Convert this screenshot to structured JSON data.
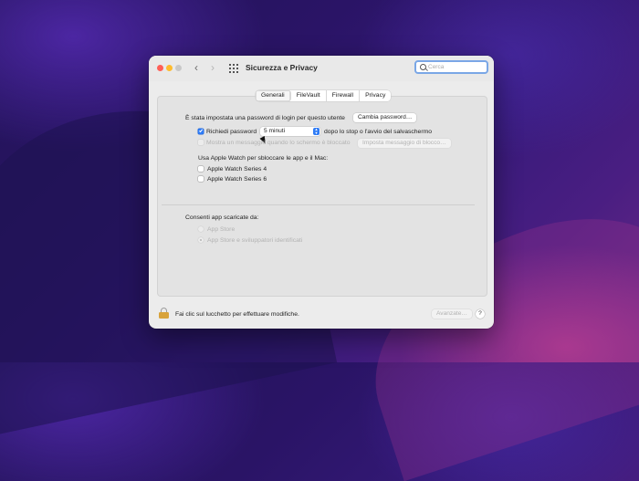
{
  "window": {
    "title": "Sicurezza e Privacy",
    "search_placeholder": "Cerca"
  },
  "tabs": [
    {
      "label": "Generali",
      "active": true
    },
    {
      "label": "FileVault",
      "active": false
    },
    {
      "label": "Firewall",
      "active": false
    },
    {
      "label": "Privacy",
      "active": false
    }
  ],
  "general": {
    "password_set_text": "È stata impostata una password di login per questo utente",
    "change_password_button": "Cambia password…",
    "require_password_label": "Richiedi password",
    "require_password_checked": true,
    "require_password_delay": "5 minuti",
    "require_password_suffix": "dopo lo stop o l'avvio del salvaschermo",
    "show_message_label": "Mostra un messaggio quando lo schermo è bloccato",
    "set_lock_message_button": "Imposta messaggio di blocco…",
    "apple_watch_title": "Usa Apple Watch per sbloccare le app e il Mac:",
    "watches": [
      {
        "label": "Apple Watch Series 4",
        "checked": false
      },
      {
        "label": "Apple Watch Series 6",
        "checked": false
      }
    ],
    "allow_apps_title": "Consenti app scaricate da:",
    "allow_options": [
      {
        "label": "App Store",
        "selected": false
      },
      {
        "label": "App Store e sviluppatori identificati",
        "selected": true
      }
    ]
  },
  "footer": {
    "lock_text": "Fai clic sul lucchetto per effettuare modifiche.",
    "advanced_button": "Avanzate…",
    "help_label": "?"
  },
  "colors": {
    "accent": "#2f7cf6",
    "close": "#ff5f57",
    "minimize": "#febc2e"
  }
}
